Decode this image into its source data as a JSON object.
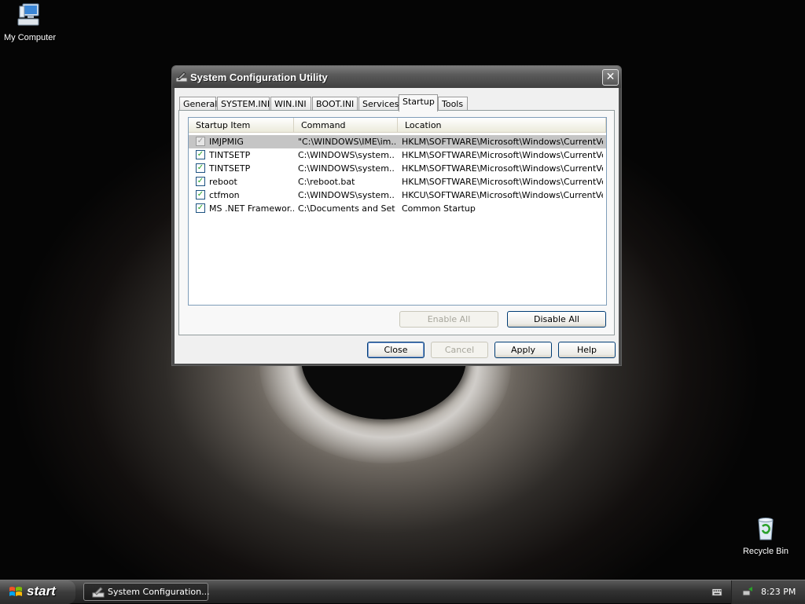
{
  "desktop": {
    "icons": {
      "my_computer": "My Computer",
      "recycle_bin": "Recycle Bin"
    }
  },
  "window": {
    "title": "System Configuration Utility",
    "close_glyph": "✕",
    "tabs": [
      "General",
      "SYSTEM.INI",
      "WIN.INI",
      "BOOT.INI",
      "Services",
      "Startup",
      "Tools"
    ],
    "active_tab": "Startup",
    "list": {
      "columns": [
        "Startup Item",
        "Command",
        "Location"
      ],
      "rows": [
        {
          "item": "IMJPMIG",
          "command": "\"C:\\WINDOWS\\IME\\im...",
          "location": "HKLM\\SOFTWARE\\Microsoft\\Windows\\CurrentVer...",
          "checked": true,
          "selected": true
        },
        {
          "item": "TINTSETP",
          "command": "C:\\WINDOWS\\system...",
          "location": "HKLM\\SOFTWARE\\Microsoft\\Windows\\CurrentVer...",
          "checked": true,
          "selected": false
        },
        {
          "item": "TINTSETP",
          "command": "C:\\WINDOWS\\system...",
          "location": "HKLM\\SOFTWARE\\Microsoft\\Windows\\CurrentVer...",
          "checked": true,
          "selected": false
        },
        {
          "item": "reboot",
          "command": "C:\\reboot.bat",
          "location": "HKLM\\SOFTWARE\\Microsoft\\Windows\\CurrentVer...",
          "checked": true,
          "selected": false
        },
        {
          "item": "ctfmon",
          "command": "C:\\WINDOWS\\system...",
          "location": "HKCU\\SOFTWARE\\Microsoft\\Windows\\CurrentVer...",
          "checked": true,
          "selected": false
        },
        {
          "item": "MS .NET Framewor...",
          "command": "C:\\Documents and Set...",
          "location": "Common Startup",
          "checked": true,
          "selected": false
        }
      ]
    },
    "panel_buttons": {
      "enable_all": "Enable All",
      "disable_all": "Disable All"
    },
    "footer_buttons": {
      "close": "Close",
      "cancel": "Cancel",
      "apply": "Apply",
      "help": "Help"
    }
  },
  "taskbar": {
    "start_label": "start",
    "task_label": "System Configuration...",
    "clock": "8:23 PM"
  }
}
